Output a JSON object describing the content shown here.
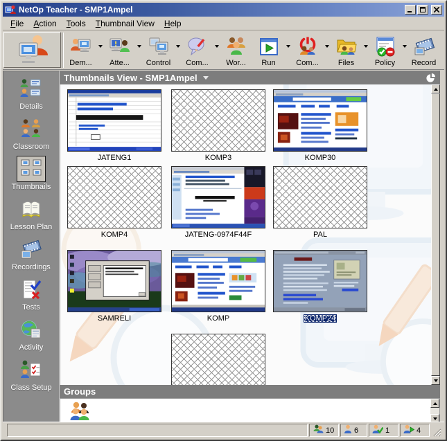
{
  "window": {
    "title": "NetOp Teacher - SMP1Ampel",
    "app_icon": "netop-logo-icon",
    "controls": [
      "minimize",
      "maximize",
      "close"
    ]
  },
  "menu": {
    "items": [
      {
        "label": "File"
      },
      {
        "label": "Action"
      },
      {
        "label": "Tools"
      },
      {
        "label": "Thumbnail View"
      },
      {
        "label": "Help"
      }
    ]
  },
  "toolbar": {
    "teacher_icon": "teacher-icon",
    "buttons": [
      {
        "label": "Dem...",
        "icon": "demonstrate-icon",
        "dropdown": true
      },
      {
        "label": "Atte...",
        "icon": "attention-icon",
        "dropdown": true
      },
      {
        "label": "Control",
        "icon": "remote-control-icon",
        "dropdown": true
      },
      {
        "label": "Com...",
        "icon": "communicate-icon",
        "dropdown": true
      },
      {
        "label": "Wor...",
        "icon": "workgroup-icon",
        "dropdown": false
      },
      {
        "label": "Run",
        "icon": "run-program-icon",
        "dropdown": true
      },
      {
        "label": "Com...",
        "icon": "commands-icon",
        "dropdown": true
      },
      {
        "label": "Files",
        "icon": "files-icon",
        "dropdown": true
      },
      {
        "label": "Policy",
        "icon": "policy-icon",
        "dropdown": true
      },
      {
        "label": "Record",
        "icon": "record-icon",
        "dropdown": false
      }
    ]
  },
  "sidebar": {
    "items": [
      {
        "label": "Details",
        "icon": "details-icon",
        "selected": false
      },
      {
        "label": "Classroom",
        "icon": "classroom-icon",
        "selected": false
      },
      {
        "label": "Thumbnails",
        "icon": "thumbnails-icon",
        "selected": true
      },
      {
        "label": "Lesson Plan",
        "icon": "lesson-plan-icon",
        "selected": false
      },
      {
        "label": "Recordings",
        "icon": "recordings-icon",
        "selected": false
      },
      {
        "label": "Tests",
        "icon": "tests-icon",
        "selected": false
      },
      {
        "label": "Activity",
        "icon": "activity-icon",
        "selected": false
      },
      {
        "label": "Class Setup",
        "icon": "class-setup-icon",
        "selected": false
      }
    ]
  },
  "view": {
    "title": "Thumbnails View - SMP1Ampel",
    "dropdown_icon": "chevron-down-icon",
    "corner_icon": "pie-icon"
  },
  "thumbnails": {
    "items": [
      {
        "name": "JATENG1",
        "state": "live",
        "selected": false
      },
      {
        "name": "KOMP3",
        "state": "empty",
        "selected": false
      },
      {
        "name": "KOMP30",
        "state": "live",
        "selected": false
      },
      {
        "name": "KOMP4",
        "state": "empty",
        "selected": false
      },
      {
        "name": "JATENG-0974F44F",
        "state": "live",
        "selected": false
      },
      {
        "name": "PAL",
        "state": "empty",
        "selected": false
      },
      {
        "name": "SAMRELI",
        "state": "live",
        "selected": false
      },
      {
        "name": "KOMP",
        "state": "live",
        "selected": false
      },
      {
        "name": "KOMP24",
        "state": "live",
        "selected": true
      },
      {
        "name": "",
        "state": "empty",
        "selected": false
      }
    ]
  },
  "groups": {
    "title": "Groups",
    "icon": "group-icon"
  },
  "status": {
    "cells": [
      {
        "icon": "students-total-icon",
        "value": "10"
      },
      {
        "icon": "student-available-icon",
        "value": "6"
      },
      {
        "icon": "student-joined-icon",
        "value": "1"
      },
      {
        "icon": "student-active-icon",
        "value": "4"
      }
    ]
  },
  "colors": {
    "titlebar_start": "#26418c",
    "titlebar_end": "#8ba3d8",
    "chrome": "#d4d0c8",
    "sidebar": "#8b8b8b",
    "section_header": "#7d7d7d",
    "selection": "#0a246a"
  }
}
